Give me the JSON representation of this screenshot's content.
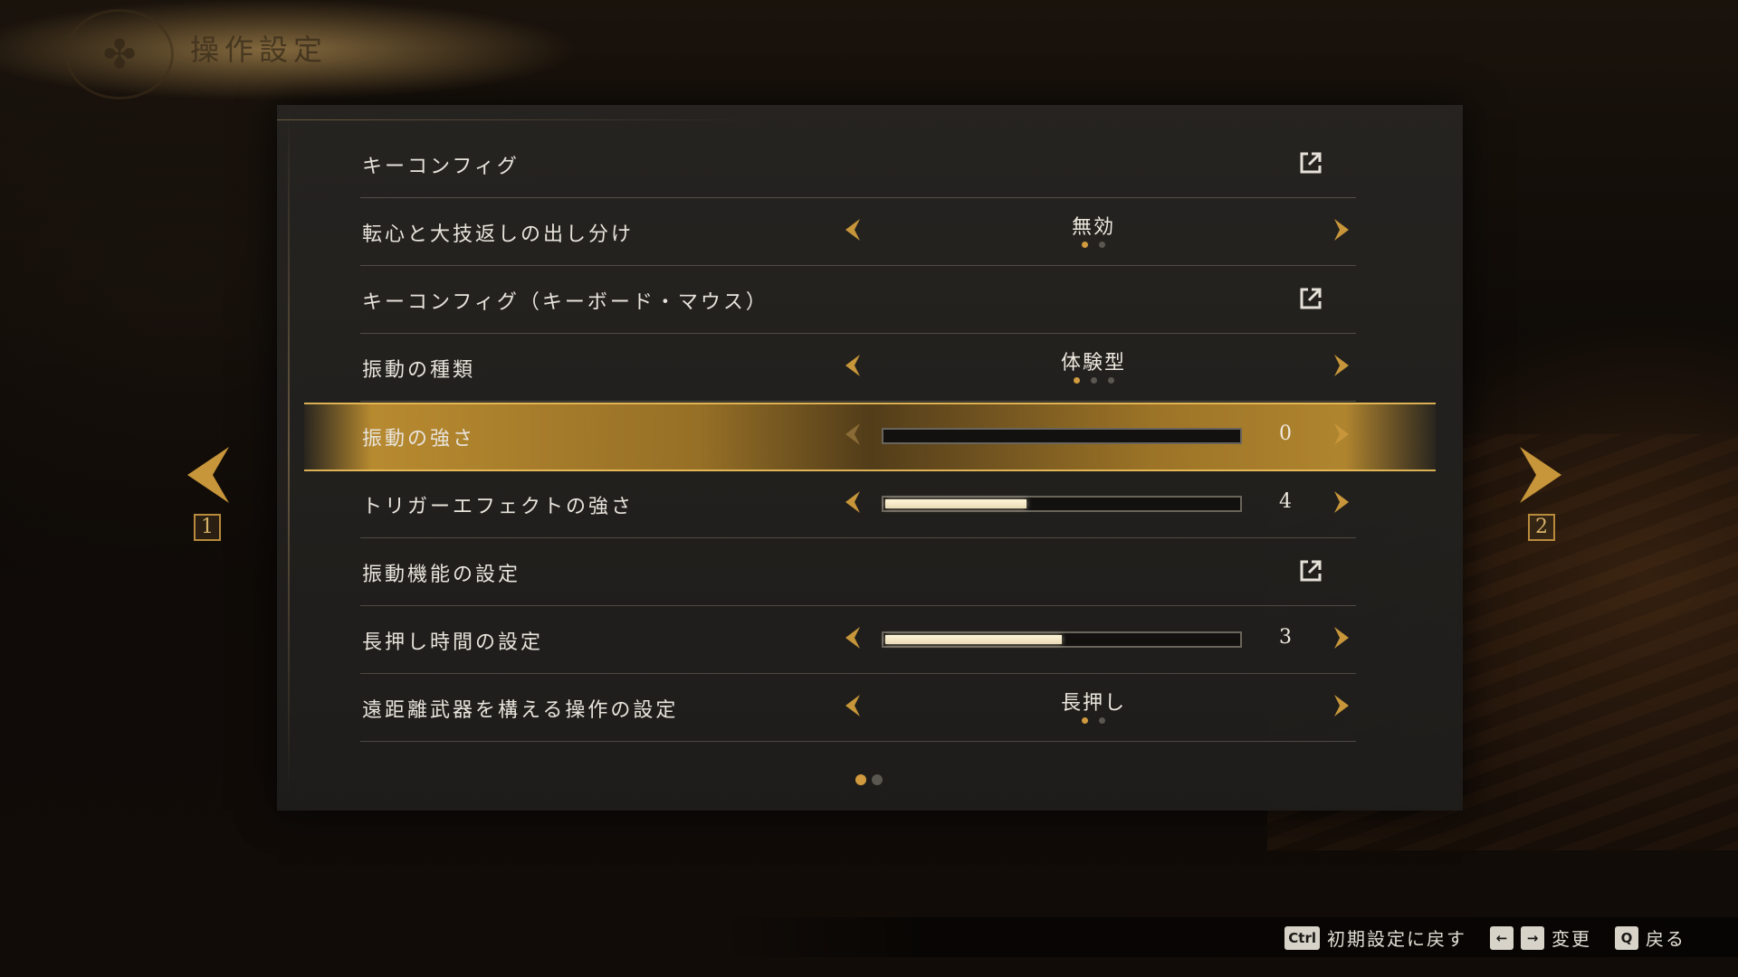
{
  "header": {
    "title": "操作設定",
    "emblem_icon": "crest-icon"
  },
  "settings": [
    {
      "label": "キーコンフィグ",
      "kind": "link"
    },
    {
      "label": "転心と大技返しの出し分け",
      "kind": "select",
      "value": "無効",
      "options_count": 2,
      "selected_index": 0
    },
    {
      "label": "キーコンフィグ（キーボード・マウス）",
      "kind": "link"
    },
    {
      "label": "振動の種類",
      "kind": "select",
      "value": "体験型",
      "options_count": 3,
      "selected_index": 0
    },
    {
      "label": "振動の強さ",
      "kind": "slider",
      "value": "0",
      "level": 0,
      "selected": true
    },
    {
      "label": "トリガーエフェクトの強さ",
      "kind": "slider",
      "value": "4",
      "level": 0.4
    },
    {
      "label": "振動機能の設定",
      "kind": "link"
    },
    {
      "label": "長押し時間の設定",
      "kind": "slider",
      "value": "3",
      "level": 0.5
    },
    {
      "label": "遠距離武器を構える操作の設定",
      "kind": "select",
      "value": "長押し",
      "options_count": 2,
      "selected_index": 0
    }
  ],
  "pagination": {
    "pages": 2,
    "current": 1
  },
  "side_nav": {
    "left_number": "1",
    "right_number": "2"
  },
  "footer": {
    "reset_key": "Ctrl",
    "reset_label": "初期設定に戻す",
    "change_keys": [
      "←",
      "→"
    ],
    "change_label": "変更",
    "back_key": "Q",
    "back_label": "戻る"
  },
  "colors": {
    "accent": "#c8963a",
    "highlight": "#b8862f",
    "panel": "#262421"
  }
}
